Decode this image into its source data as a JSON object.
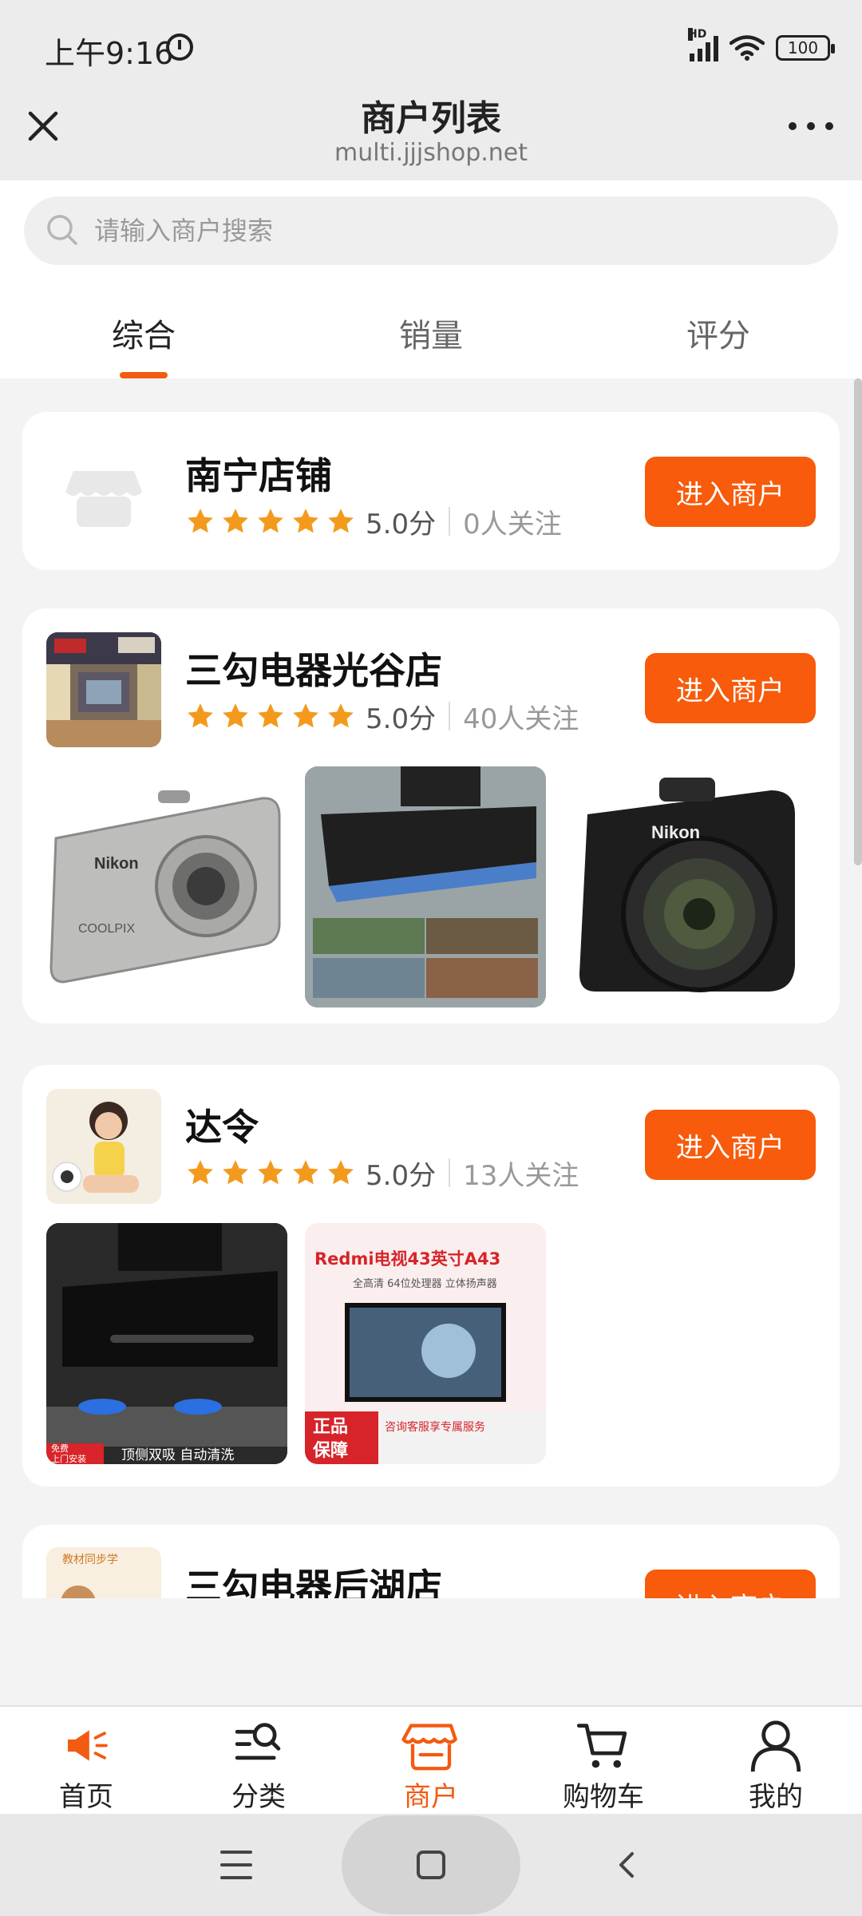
{
  "status_bar": {
    "time": "上午9:16",
    "battery": "100",
    "network": "HD"
  },
  "nav": {
    "title": "商户列表",
    "subtitle": "multi.jjjshop.net"
  },
  "search": {
    "placeholder": "请输入商户搜索"
  },
  "tabs": [
    {
      "label": "综合",
      "active": true
    },
    {
      "label": "销量",
      "active": false
    },
    {
      "label": "评分",
      "active": false
    }
  ],
  "merchants": [
    {
      "name": "南宁店铺",
      "score": "5.0分",
      "followers": "0人关注",
      "button": "进入商户",
      "stars": 5
    },
    {
      "name": "三勾电器光谷店",
      "score": "5.0分",
      "followers": "40人关注",
      "button": "进入商户",
      "stars": 5,
      "product_images": [
        "silver-compact-camera",
        "range-hood-with-features",
        "black-dslr-camera"
      ],
      "product_texts": {
        "camera1_brand": "Nikon",
        "camera1_model": "COOLPIX",
        "camera2_brand": "Nikon"
      }
    },
    {
      "name": "达令",
      "score": "5.0分",
      "followers": "13人关注",
      "button": "进入商户",
      "stars": 5,
      "product_images": [
        "black-range-hood-and-stove",
        "redmi-tv"
      ],
      "product_texts": {
        "stove_tag1": "免费",
        "stove_tag2": "上门安装",
        "stove_caption": "顶侧双吸 自动清洗",
        "tv_title": "Redmi电视43英寸A43",
        "tv_features": "全高清  64位处理器  立体扬声器",
        "tv_badge_line1": "正品",
        "tv_badge_line2": "保障",
        "tv_service": "咨询客服享专属服务"
      }
    },
    {
      "name": "三勾电器后湖店",
      "button": "进入商户",
      "logo_text": "教材同步学"
    }
  ],
  "bottom_nav": [
    {
      "label": "首页",
      "icon": "megaphone-icon",
      "active": false
    },
    {
      "label": "分类",
      "icon": "category-search-icon",
      "active": false
    },
    {
      "label": "商户",
      "icon": "store-icon",
      "active": true
    },
    {
      "label": "购物车",
      "icon": "cart-icon",
      "active": false
    },
    {
      "label": "我的",
      "icon": "user-icon",
      "active": false
    }
  ],
  "colors": {
    "accent": "#f75b0b",
    "star": "#f39a1d"
  }
}
